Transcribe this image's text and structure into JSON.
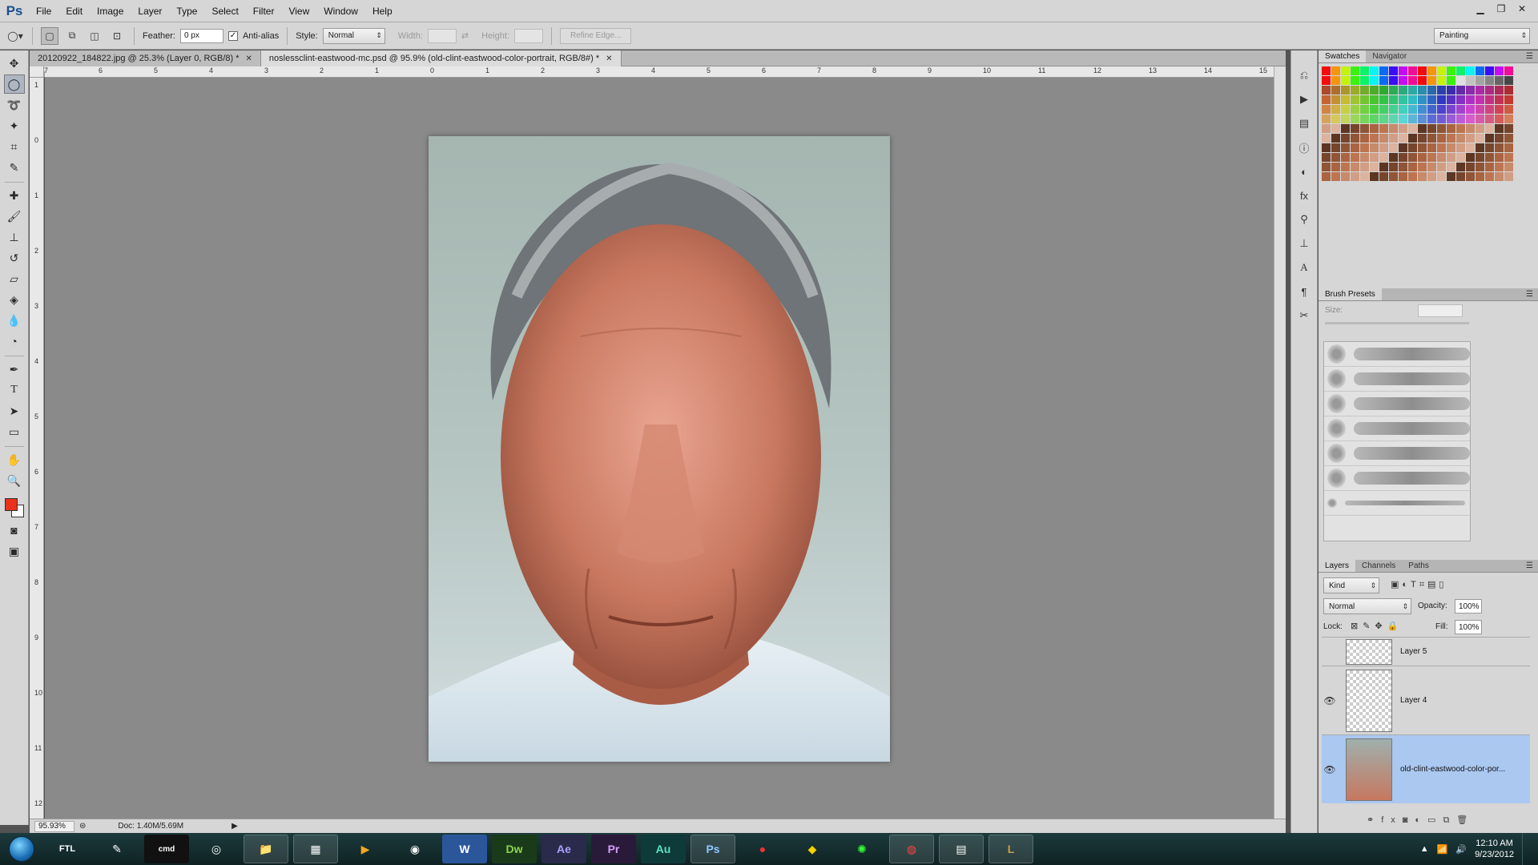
{
  "app": {
    "logo": "Ps"
  },
  "menu": [
    "File",
    "Edit",
    "Image",
    "Layer",
    "Type",
    "Select",
    "Filter",
    "View",
    "Window",
    "Help"
  ],
  "window_controls": [
    "minimize",
    "restore",
    "close"
  ],
  "options": {
    "feather_label": "Feather:",
    "feather_value": "0 px",
    "antialias_label": "Anti-alias",
    "antialias_checked": true,
    "style_label": "Style:",
    "style_value": "Normal",
    "width_label": "Width:",
    "height_label": "Height:",
    "refine_edge": "Refine Edge...",
    "workspace": "Painting"
  },
  "doc_tabs": [
    {
      "label": "20120922_184822.jpg @ 25.3% (Layer 0, RGB/8) *",
      "active": false
    },
    {
      "label": "noslessclint-eastwood-mc.psd @ 95.9% (old-clint-eastwood-color-portrait, RGB/8#) *",
      "active": true
    }
  ],
  "ruler_top": [
    "7",
    "6",
    "5",
    "4",
    "3",
    "2",
    "1",
    "0",
    "1",
    "2",
    "3",
    "4",
    "5",
    "6",
    "7",
    "8",
    "9",
    "10",
    "11",
    "12",
    "13",
    "14",
    "15"
  ],
  "ruler_left": [
    "1",
    "0",
    "1",
    "2",
    "3",
    "4",
    "5",
    "6",
    "7",
    "8",
    "9",
    "10",
    "11",
    "12"
  ],
  "status": {
    "zoom": "95.93%",
    "doc": "Doc: 1.40M/5.69M"
  },
  "colors": {
    "foreground": "#e8321c",
    "background": "#ffffff",
    "selection": "#aac8f0"
  },
  "panels": {
    "swatches_tabs": [
      "Swatches",
      "Navigator"
    ],
    "brush_tab": "Brush Presets",
    "brush_size_label": "Size:",
    "layers_tabs": [
      "Layers",
      "Channels",
      "Paths"
    ],
    "kind_filter": "Kind",
    "blend_mode": "Normal",
    "opacity_label": "Opacity:",
    "opacity_value": "100%",
    "lock_label": "Lock:",
    "fill_label": "Fill:",
    "fill_value": "100%"
  },
  "layers": [
    {
      "name": "Layer 5",
      "visible": false
    },
    {
      "name": "Layer 4",
      "visible": true
    },
    {
      "name": "old-clint-eastwood-color-por...",
      "visible": true,
      "selected": true
    }
  ],
  "taskbar": {
    "apps": [
      "FTL",
      "",
      "cmd",
      "",
      "Explorer",
      "",
      "Media",
      "Chrome",
      "W",
      "Dw",
      "Ae",
      "Pr",
      "Au",
      "Ps",
      "",
      "",
      "",
      "",
      "",
      "L"
    ],
    "time": "12:10 AM",
    "date": "9/23/2012"
  }
}
